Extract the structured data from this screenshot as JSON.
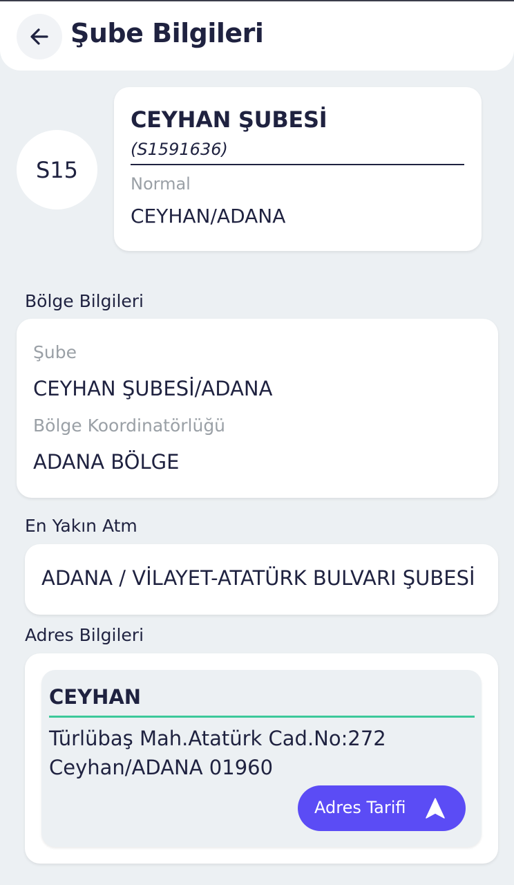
{
  "header": {
    "title": "Şube Bilgileri",
    "back_icon": "arrow-left-icon"
  },
  "branch": {
    "avatar_text": "S15",
    "name": "CEYHAN ŞUBESİ",
    "code": "(S1591636)",
    "type": "Normal",
    "city": "CEYHAN/ADANA"
  },
  "region": {
    "section_label": "Bölge Bilgileri",
    "branch_label": "Şube",
    "branch_value": "CEYHAN ŞUBESİ/ADANA",
    "coordinator_label": "Bölge Koordinatörlüğü",
    "coordinator_value": "ADANA BÖLGE"
  },
  "atm": {
    "section_label": "En Yakın Atm",
    "value": "ADANA / VİLAYET-ATATÜRK BULVARI ŞUBESİ"
  },
  "address": {
    "section_label": "Adres Bilgileri",
    "title": "CEYHAN",
    "line1": "Türlübaş Mah.Atatürk Cad.No:272",
    "line2": "Ceyhan/ADANA 01960",
    "directions_label": "Adres Tarifi",
    "directions_icon": "navigation-arrow-icon"
  },
  "colors": {
    "background": "#ecf0f3",
    "text_primary": "#1f2240",
    "text_muted": "#9aa0a6",
    "accent": "#5b4cf5",
    "divider_accent": "#3cc99a"
  }
}
